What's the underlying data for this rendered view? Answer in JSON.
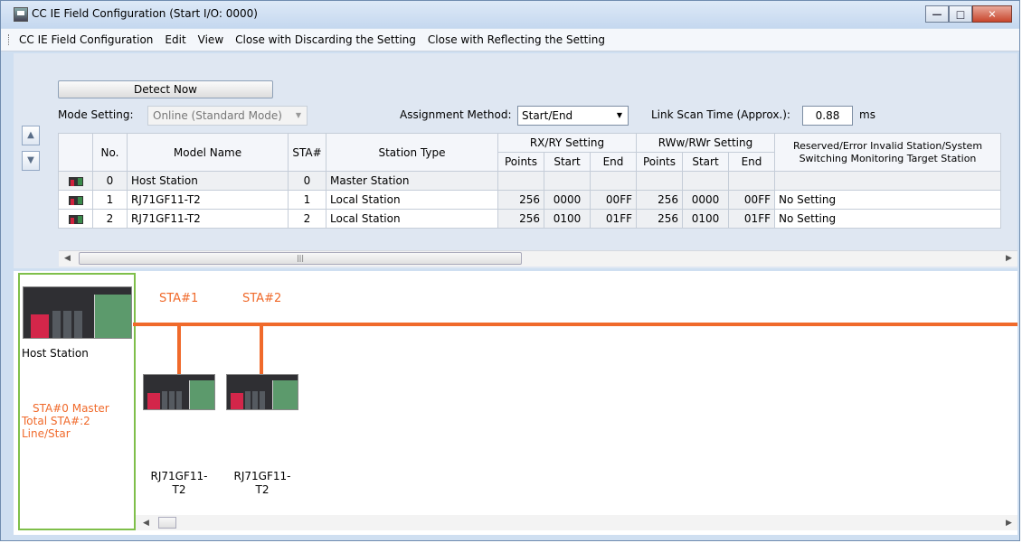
{
  "window": {
    "title": "CC IE Field Configuration (Start I/O: 0000)"
  },
  "menu": [
    "CC IE Field Configuration",
    "Edit",
    "View",
    "Close with Discarding the Setting",
    "Close with Reflecting the Setting"
  ],
  "toolbar": {
    "detect_label": "Detect Now",
    "mode_label": "Mode Setting:",
    "mode_value": "Online (Standard Mode)",
    "assign_label": "Assignment Method:",
    "assign_value": "Start/End",
    "scan_label": "Link Scan Time (Approx.):",
    "scan_value": "0.88",
    "scan_unit": "ms"
  },
  "table": {
    "headers": {
      "no": "No.",
      "model": "Model Name",
      "sta": "STA#",
      "type": "Station Type",
      "rx": "RX/RY Setting",
      "rw": "RWw/RWr Setting",
      "reserved1": "Reserved/Error Invalid Station/System",
      "reserved2": "Switching Monitoring Target Station",
      "points": "Points",
      "start": "Start",
      "end": "End"
    },
    "rows": [
      {
        "no": "0",
        "model": "Host Station",
        "sta": "0",
        "type": "Master Station",
        "rx_points": "",
        "rx_start": "",
        "rx_end": "",
        "rw_points": "",
        "rw_start": "",
        "rw_end": "",
        "reserved": ""
      },
      {
        "no": "1",
        "model": "RJ71GF11-T2",
        "sta": "1",
        "type": "Local Station",
        "rx_points": "256",
        "rx_start": "0000",
        "rx_end": "00FF",
        "rw_points": "256",
        "rw_start": "0000",
        "rw_end": "00FF",
        "reserved": "No Setting"
      },
      {
        "no": "2",
        "model": "RJ71GF11-T2",
        "sta": "2",
        "type": "Local Station",
        "rx_points": "256",
        "rx_start": "0100",
        "rx_end": "01FF",
        "rw_points": "256",
        "rw_start": "0100",
        "rw_end": "01FF",
        "reserved": "No Setting"
      }
    ]
  },
  "diagram": {
    "host_label": "Host Station",
    "info_line1": "STA#0  Master",
    "info_line2": "Total STA#:2",
    "info_line3": "Line/Star",
    "sta1": "STA#1",
    "sta2": "STA#2",
    "dev1_line1": "RJ71GF11-",
    "dev1_line2": "T2",
    "dev2_line1": "RJ71GF11-",
    "dev2_line2": "T2"
  },
  "colors": {
    "accent": "#f06a2b",
    "host_border": "#7fbf4a"
  }
}
